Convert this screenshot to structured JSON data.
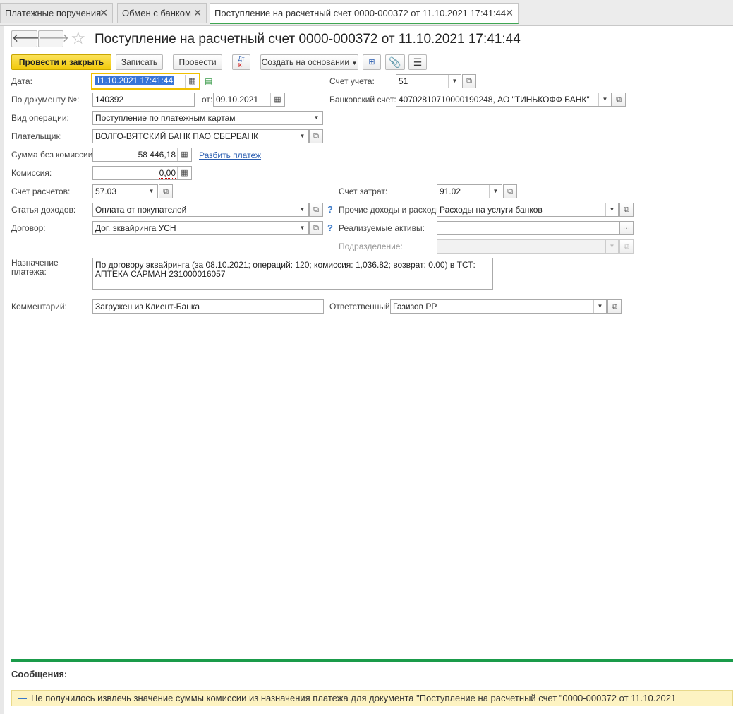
{
  "tabs": [
    {
      "label": "Платежные поручения"
    },
    {
      "label": "Обмен с банком"
    },
    {
      "label": "Поступление на расчетный счет 0000-000372 от 11.10.2021 17:41:44"
    }
  ],
  "header": {
    "back": "🡐",
    "forward": "🡒",
    "title": "Поступление на расчетный счет 0000-000372 от 11.10.2021 17:41:44"
  },
  "toolbar": {
    "post_close": "Провести и закрыть",
    "save": "Записать",
    "post": "Провести",
    "dt": "Дт",
    "kt": "Кт",
    "create_based": "Создать на основании"
  },
  "form": {
    "date_label": "Дата:",
    "date_value": "11.10.2021 17:41:44",
    "account_label": "Счет учета:",
    "account_value": "51",
    "doc_no_label": "По документу №:",
    "doc_no_value": "140392",
    "from_label": "от:",
    "from_value": "09.10.2021",
    "bank_account_label": "Банковский счет:",
    "bank_account_value": "40702810710000190248, АО \"ТИНЬКОФФ БАНК\"",
    "operation_label": "Вид операции:",
    "operation_value": "Поступление по платежным картам",
    "payer_label": "Плательщик:",
    "payer_value": "ВОЛГО-ВЯТСКИЙ БАНК ПАО СБЕРБАНК",
    "sum_label": "Сумма без комиссии:",
    "sum_value": "58 446,18",
    "split_link": "Разбить платеж",
    "commission_label": "Комиссия:",
    "commission_value": "0,00",
    "settlement_label": "Счет расчетов:",
    "settlement_value": "57.03",
    "cost_account_label": "Счет затрат:",
    "cost_account_value": "91.02",
    "income_item_label": "Статья доходов:",
    "income_item_value": "Оплата от покупателей",
    "other_label": "Прочие доходы и расходы:",
    "other_value": "Расходы на услуги банков",
    "contract_label": "Договор:",
    "contract_value": "Дог. эквайринга УСН",
    "assets_label": "Реализуемые активы:",
    "assets_value": "",
    "division_label": "Подразделение:",
    "division_value": "",
    "purpose_label": "Назначение платежа:",
    "purpose_value": "По договору эквайринга (за 08.10.2021; операций: 120; комиссия: 1,036.82;  возврат: 0.00) в ТСТ: АПТЕКА САРМАН 231000016057",
    "comment_label": "Комментарий:",
    "comment_value": "Загружен из Клиент-Банка",
    "responsible_label": "Ответственный:",
    "responsible_value": "Газизов РР",
    "help": "?"
  },
  "messages": {
    "title": "Сообщения:",
    "text": "Не получилось извлечь значение суммы комиссии из назначения платежа для документа \"Поступление на расчетный счет \"0000-000372 от 11.10.2021"
  }
}
